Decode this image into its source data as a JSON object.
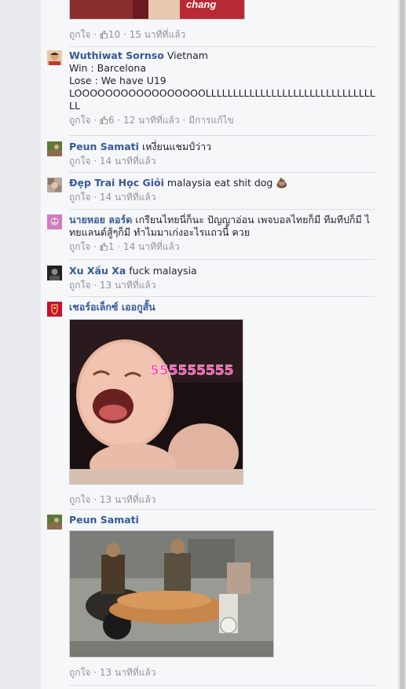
{
  "comments": [
    {
      "likes_label": "ถูกใจ",
      "like_count": "10",
      "time": "15 นาทีที่แล้ว"
    },
    {
      "author": "Wuthiwat Sornso",
      "text": "Vietnam\nWin : Barcelona\nLose : We have U19\nLOOOOOOOOOOOOOOOOOLLLLLLLLLLLLLLLLLLLLLLLLLLLLLLLLL",
      "likes_label": "ถูกใจ",
      "like_count": "6",
      "time": "12 นาทีที่แล้ว",
      "edited": "มีการแก้ไข"
    },
    {
      "author": "Peun Samati",
      "text": "เหงี่ยนแชมป์ว่าว",
      "likes_label": "ถูกใจ",
      "time": "14 นาทีที่แล้ว"
    },
    {
      "author": "Đẹp Trai Học Giỏi",
      "text": "malaysia eat shit dog 💩",
      "likes_label": "ถูกใจ",
      "time": "14 นาทีที่แล้ว"
    },
    {
      "author": "นายหอย ลอร์ด",
      "text": "เกรียนไทยนี่ก็นะ ปัญญาอ่อน เพจบอลไทยก็มี ทีมทีปก็มี ไทยแลนด์สู้ๆก็มี ทำไมมาเก่งอะไรแถวนี้ ควย",
      "likes_label": "ถูกใจ",
      "like_count": "1",
      "time": "14 นาทีที่แล้ว"
    },
    {
      "author": "Xu Xấu Xa",
      "text": "fuck malaysia",
      "likes_label": "ถูกใจ",
      "time": "13 นาทีที่แล้ว"
    },
    {
      "author": "เชอร์อเล็กซ์ เออกูสั้น",
      "photo_caption": "555555555",
      "likes_label": "ถูกใจ",
      "time": "13 นาทีที่แล้ว"
    },
    {
      "author": "Peun Samati",
      "likes_label": "ถูกใจ",
      "time": "13 นาทีที่แล้ว"
    }
  ],
  "colors": {
    "author": "#365899",
    "meta": "#90949c",
    "divider": "#dcdee3"
  },
  "icons": {
    "like": "thumbs-up-icon",
    "poop": "poop-emoji"
  }
}
